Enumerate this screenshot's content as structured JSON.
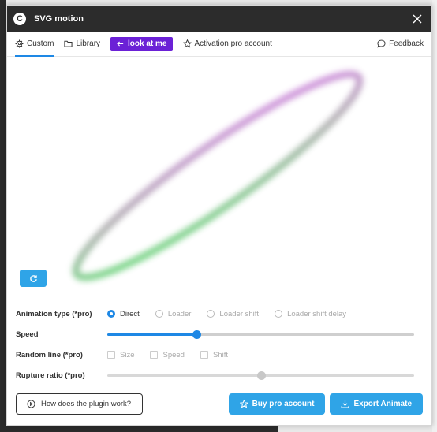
{
  "window": {
    "title": "SVG motion",
    "logo_glyph": "C"
  },
  "tabs": [
    {
      "label": "Custom",
      "icon": "gear-icon",
      "active": true
    },
    {
      "label": "Library",
      "icon": "folder-icon"
    },
    {
      "label": "look at me",
      "icon": "arrow-left-icon"
    },
    {
      "label": "Activation pro account",
      "icon": "star-icon"
    },
    {
      "label": "Feedback",
      "icon": "chat-icon"
    }
  ],
  "canvas": {
    "gradient_start": "#55e06a",
    "gradient_end": "#d57be8",
    "refresh_icon": "refresh-icon"
  },
  "controls": {
    "animation_type": {
      "label": "Animation type (*pro)",
      "options": [
        "Direct",
        "Loader",
        "Loader shift",
        "Loader shift delay"
      ],
      "selected": "Direct"
    },
    "speed": {
      "label": "Speed",
      "value_fraction": 0.29
    },
    "random_line": {
      "label": "Random line (*pro)",
      "options": [
        "Size",
        "Speed",
        "Shift"
      ]
    },
    "rupture_ratio": {
      "label": "Rupture ratio (*pro)",
      "value_fraction": 0.5
    }
  },
  "footer": {
    "help_label": "How does the plugin work?",
    "buy_label": "Buy pro account",
    "export_label": "Export Animate"
  },
  "colors": {
    "accent": "#1e88e5",
    "button_blue": "#2fa4e7",
    "pill_purple": "#6b21d6",
    "titlebar": "#2c2c2c"
  }
}
